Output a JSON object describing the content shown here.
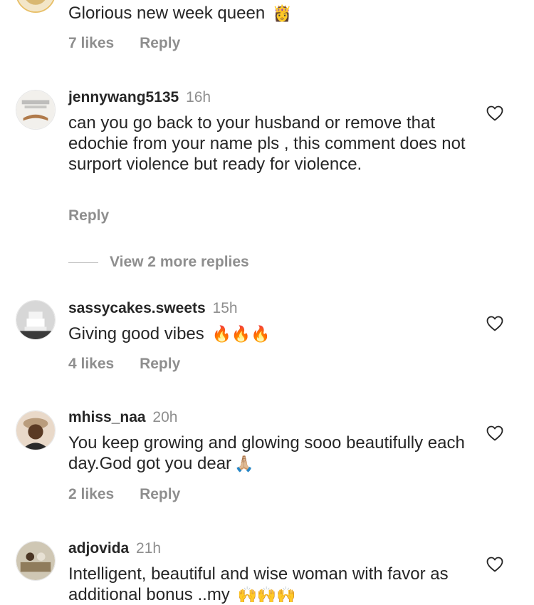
{
  "comments": [
    {
      "body": "Glorious new week queen",
      "emoji": "👸",
      "likes": "7 likes",
      "reply": "Reply"
    },
    {
      "username": "jennywang5135",
      "time": "16h",
      "body": "can you go back to your husband or remove that edochie from your name pls , this comment does not surport violence but ready for violence.",
      "reply": "Reply",
      "view_replies": "View 2 more replies"
    },
    {
      "username": "sassycakes.sweets",
      "time": "15h",
      "body": "Giving good vibes",
      "emoji": "🔥🔥🔥",
      "likes": "4 likes",
      "reply": "Reply"
    },
    {
      "username": "mhiss_naa",
      "time": "20h",
      "body": "You keep growing and glowing sooo beautifully each day.God got you dear",
      "emoji": "🙏🏼",
      "likes": "2 likes",
      "reply": "Reply"
    },
    {
      "username": "adjovida",
      "time": "21h",
      "body": "Intelligent, beautiful and wise woman with favor as additional bonus ..my",
      "emoji": "🙌🙌🙌"
    }
  ],
  "icons": {
    "like": "heart-outline-icon"
  },
  "colors": {
    "text": "#262626",
    "secondary": "#8e8e8e"
  }
}
